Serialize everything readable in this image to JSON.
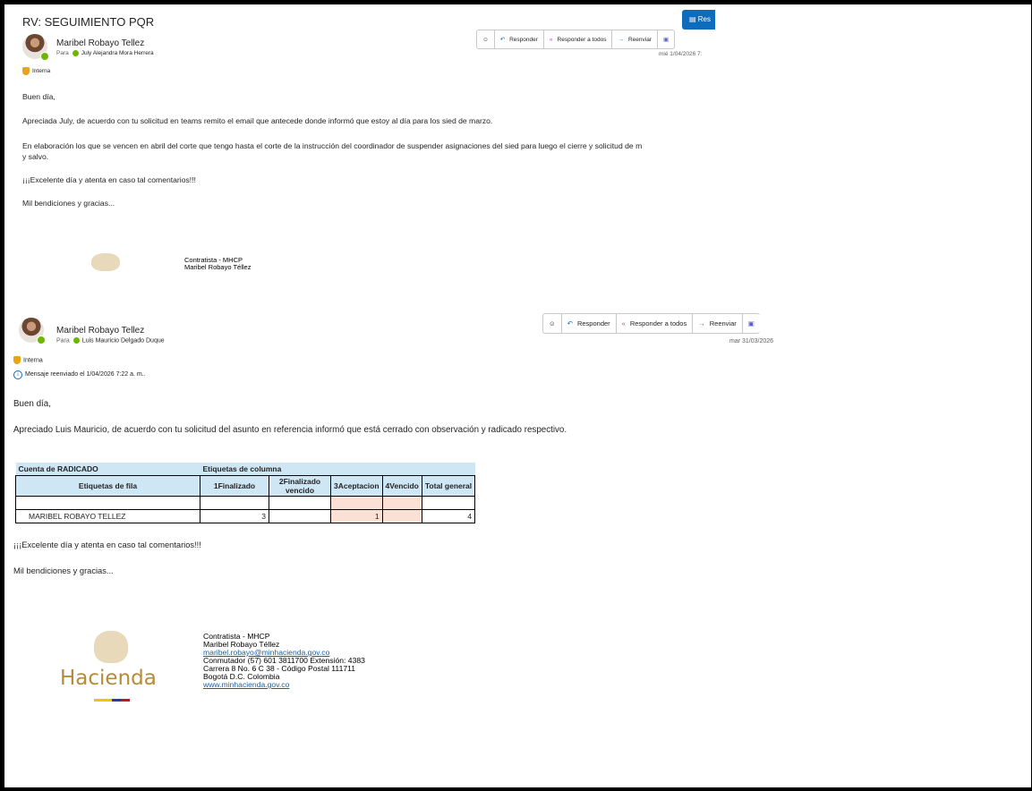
{
  "subject": "RV: SEGUIMIENTO PQR",
  "top_button": "Res",
  "email1": {
    "sender": "Maribel Robayo Tellez",
    "to_label": "Para",
    "to": "July Alejandra Mora Herrera",
    "label": "Interna",
    "actions": [
      "Responder",
      "Responder a todos",
      "Reenviar"
    ],
    "date": "mié 1/04/2026 7:",
    "greeting": "Buen día,",
    "p1": "Apreciada July, de acuerdo con tu solicitud en teams remito el email que antecede donde informó que estoy al día para los sied de marzo.",
    "p2a": "En elaboración los que se vencen en abril del corte que tengo hasta el corte de la instrucción del coordinador de suspender asignaciones del sied para luego el cierre y solicitud de m",
    "p2b": "y salvo.",
    "p3": "¡¡¡Excelente día y atenta en caso tal comentarios!!!",
    "p4": "Mil bendiciones y gracias...",
    "sig1": "Contratista - MHCP",
    "sig2": "Maribel Robayo Téllez"
  },
  "email2": {
    "sender": "Maribel Robayo Tellez",
    "to_label": "Para",
    "to": "Luis Mauricio Delgado Duque",
    "label": "Interna",
    "forwarded": "Mensaje reenviado el 1/04/2026 7:22 a. m..",
    "actions": [
      "Responder",
      "Responder a todos",
      "Reenviar"
    ],
    "date": "mar 31/03/2026",
    "greeting": "Buen día,",
    "p1": "Apreciado Luis Mauricio, de acuerdo con tu solicitud del asunto en referencia informó que está cerrado con observación y radicado respectivo.",
    "p3": "¡¡¡Excelente día y atenta en caso tal comentarios!!!",
    "p4": "Mil bendiciones y gracias...",
    "table": {
      "corner": "Cuenta de RADICADO",
      "col_label": "Etiquetas de columna",
      "row_label": "Etiquetas de fila",
      "headers": [
        "1Finalizado",
        "2Finalizado vencido",
        "3Aceptacion",
        "4Vencido",
        "Total general"
      ],
      "row_name": "MARIBEL ROBAYO TELLEZ",
      "values": [
        "3",
        "",
        "1",
        "",
        "4"
      ]
    },
    "sig": {
      "l1": "Contratista - MHCP",
      "l2": "Maribel Robayo Téllez",
      "email": "maribel.robayo@minhacienda.gov.co",
      "l4": "Conmutador (57) 601 3811700 Extensión: 4383",
      "l5": "Carrera 8 No. 6 C 38 - Código Postal 111711",
      "l6": "Bogotá D.C. Colombia",
      "web": "www.minhacienda.gov.co",
      "logo": "Hacienda"
    }
  }
}
